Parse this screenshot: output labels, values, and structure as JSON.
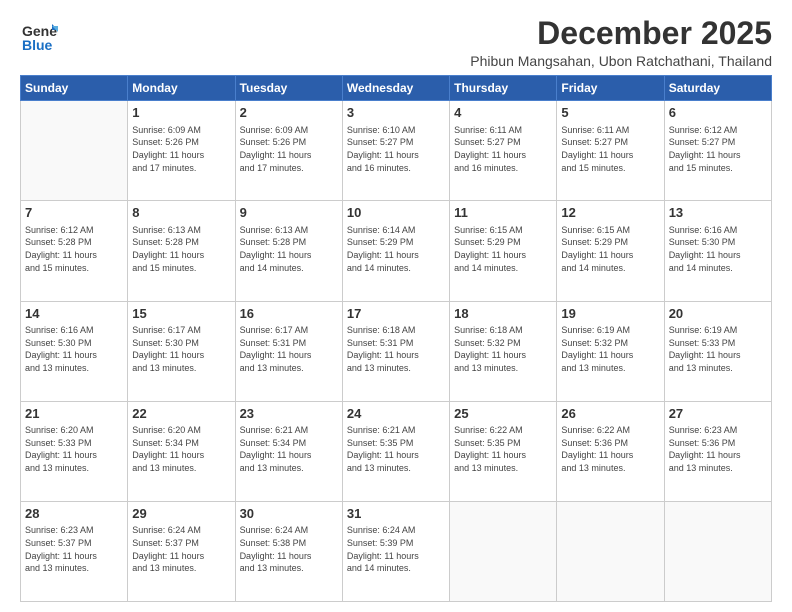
{
  "app": {
    "logo_line1": "General",
    "logo_line2": "Blue"
  },
  "header": {
    "month_title": "December 2025",
    "location": "Phibun Mangsahan, Ubon Ratchathani, Thailand"
  },
  "weekdays": [
    "Sunday",
    "Monday",
    "Tuesday",
    "Wednesday",
    "Thursday",
    "Friday",
    "Saturday"
  ],
  "weeks": [
    [
      {
        "day": "",
        "info": ""
      },
      {
        "day": "1",
        "info": "Sunrise: 6:09 AM\nSunset: 5:26 PM\nDaylight: 11 hours\nand 17 minutes."
      },
      {
        "day": "2",
        "info": "Sunrise: 6:09 AM\nSunset: 5:26 PM\nDaylight: 11 hours\nand 17 minutes."
      },
      {
        "day": "3",
        "info": "Sunrise: 6:10 AM\nSunset: 5:27 PM\nDaylight: 11 hours\nand 16 minutes."
      },
      {
        "day": "4",
        "info": "Sunrise: 6:11 AM\nSunset: 5:27 PM\nDaylight: 11 hours\nand 16 minutes."
      },
      {
        "day": "5",
        "info": "Sunrise: 6:11 AM\nSunset: 5:27 PM\nDaylight: 11 hours\nand 15 minutes."
      },
      {
        "day": "6",
        "info": "Sunrise: 6:12 AM\nSunset: 5:27 PM\nDaylight: 11 hours\nand 15 minutes."
      }
    ],
    [
      {
        "day": "7",
        "info": "Sunrise: 6:12 AM\nSunset: 5:28 PM\nDaylight: 11 hours\nand 15 minutes."
      },
      {
        "day": "8",
        "info": "Sunrise: 6:13 AM\nSunset: 5:28 PM\nDaylight: 11 hours\nand 15 minutes."
      },
      {
        "day": "9",
        "info": "Sunrise: 6:13 AM\nSunset: 5:28 PM\nDaylight: 11 hours\nand 14 minutes."
      },
      {
        "day": "10",
        "info": "Sunrise: 6:14 AM\nSunset: 5:29 PM\nDaylight: 11 hours\nand 14 minutes."
      },
      {
        "day": "11",
        "info": "Sunrise: 6:15 AM\nSunset: 5:29 PM\nDaylight: 11 hours\nand 14 minutes."
      },
      {
        "day": "12",
        "info": "Sunrise: 6:15 AM\nSunset: 5:29 PM\nDaylight: 11 hours\nand 14 minutes."
      },
      {
        "day": "13",
        "info": "Sunrise: 6:16 AM\nSunset: 5:30 PM\nDaylight: 11 hours\nand 14 minutes."
      }
    ],
    [
      {
        "day": "14",
        "info": "Sunrise: 6:16 AM\nSunset: 5:30 PM\nDaylight: 11 hours\nand 13 minutes."
      },
      {
        "day": "15",
        "info": "Sunrise: 6:17 AM\nSunset: 5:30 PM\nDaylight: 11 hours\nand 13 minutes."
      },
      {
        "day": "16",
        "info": "Sunrise: 6:17 AM\nSunset: 5:31 PM\nDaylight: 11 hours\nand 13 minutes."
      },
      {
        "day": "17",
        "info": "Sunrise: 6:18 AM\nSunset: 5:31 PM\nDaylight: 11 hours\nand 13 minutes."
      },
      {
        "day": "18",
        "info": "Sunrise: 6:18 AM\nSunset: 5:32 PM\nDaylight: 11 hours\nand 13 minutes."
      },
      {
        "day": "19",
        "info": "Sunrise: 6:19 AM\nSunset: 5:32 PM\nDaylight: 11 hours\nand 13 minutes."
      },
      {
        "day": "20",
        "info": "Sunrise: 6:19 AM\nSunset: 5:33 PM\nDaylight: 11 hours\nand 13 minutes."
      }
    ],
    [
      {
        "day": "21",
        "info": "Sunrise: 6:20 AM\nSunset: 5:33 PM\nDaylight: 11 hours\nand 13 minutes."
      },
      {
        "day": "22",
        "info": "Sunrise: 6:20 AM\nSunset: 5:34 PM\nDaylight: 11 hours\nand 13 minutes."
      },
      {
        "day": "23",
        "info": "Sunrise: 6:21 AM\nSunset: 5:34 PM\nDaylight: 11 hours\nand 13 minutes."
      },
      {
        "day": "24",
        "info": "Sunrise: 6:21 AM\nSunset: 5:35 PM\nDaylight: 11 hours\nand 13 minutes."
      },
      {
        "day": "25",
        "info": "Sunrise: 6:22 AM\nSunset: 5:35 PM\nDaylight: 11 hours\nand 13 minutes."
      },
      {
        "day": "26",
        "info": "Sunrise: 6:22 AM\nSunset: 5:36 PM\nDaylight: 11 hours\nand 13 minutes."
      },
      {
        "day": "27",
        "info": "Sunrise: 6:23 AM\nSunset: 5:36 PM\nDaylight: 11 hours\nand 13 minutes."
      }
    ],
    [
      {
        "day": "28",
        "info": "Sunrise: 6:23 AM\nSunset: 5:37 PM\nDaylight: 11 hours\nand 13 minutes."
      },
      {
        "day": "29",
        "info": "Sunrise: 6:24 AM\nSunset: 5:37 PM\nDaylight: 11 hours\nand 13 minutes."
      },
      {
        "day": "30",
        "info": "Sunrise: 6:24 AM\nSunset: 5:38 PM\nDaylight: 11 hours\nand 13 minutes."
      },
      {
        "day": "31",
        "info": "Sunrise: 6:24 AM\nSunset: 5:39 PM\nDaylight: 11 hours\nand 14 minutes."
      },
      {
        "day": "",
        "info": ""
      },
      {
        "day": "",
        "info": ""
      },
      {
        "day": "",
        "info": ""
      }
    ]
  ]
}
